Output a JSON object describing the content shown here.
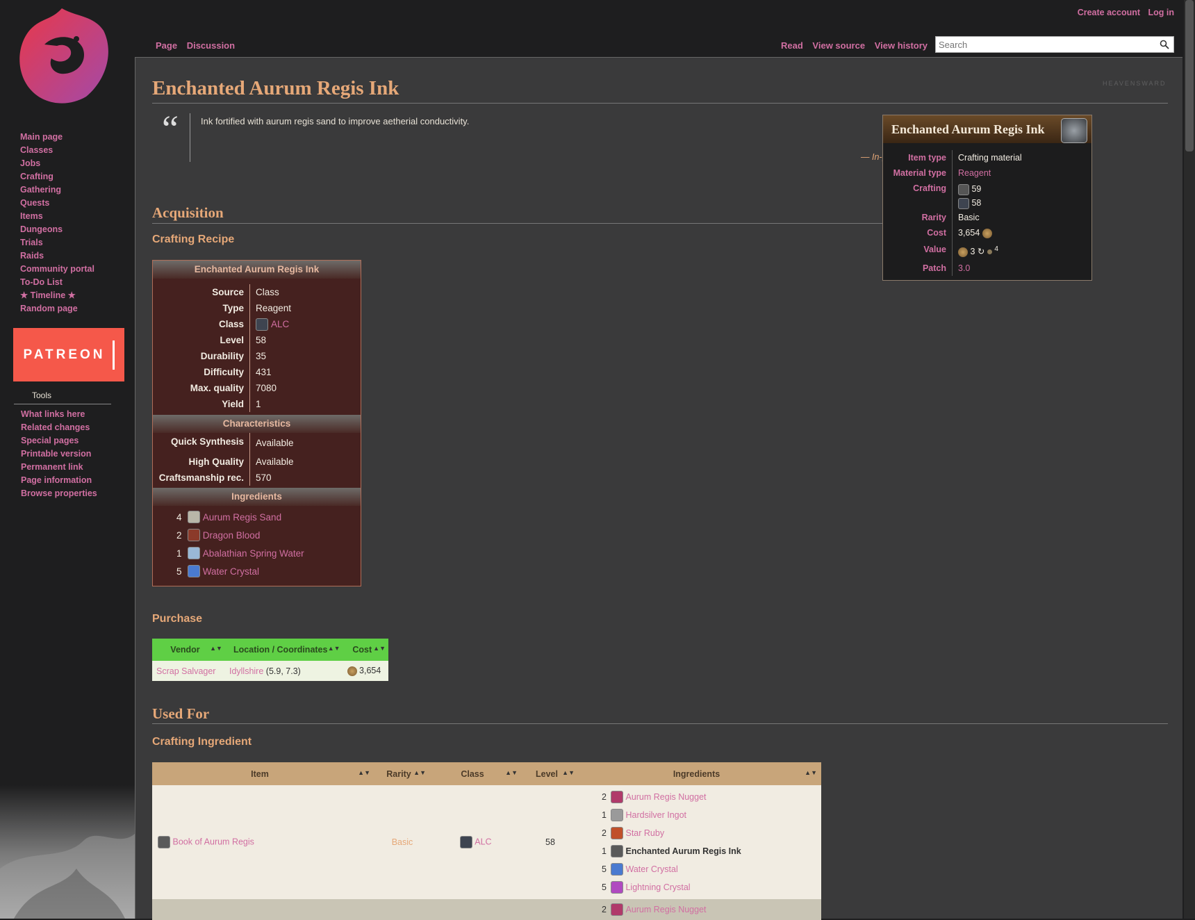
{
  "header": {
    "create_account": "Create account",
    "log_in": "Log in",
    "tab_page": "Page",
    "tab_discussion": "Discussion",
    "tab_read": "Read",
    "tab_view_source": "View source",
    "tab_view_history": "View history",
    "search_placeholder": "Search"
  },
  "sidebar": {
    "nav": [
      "Main page",
      "Classes",
      "Jobs",
      "Crafting",
      "Gathering",
      "Quests",
      "Items",
      "Dungeons",
      "Trials",
      "Raids",
      "Community portal",
      "To-Do List",
      "★ Timeline ★",
      "Random page"
    ],
    "patreon": "PATREON",
    "tools_heading": "Tools",
    "tools": [
      "What links here",
      "Related changes",
      "Special pages",
      "Printable version",
      "Permanent link",
      "Page information",
      "Browse properties"
    ]
  },
  "page": {
    "title": "Enchanted Aurum Regis Ink",
    "watermark": "HEAVENSWARD",
    "quote": "Ink fortified with aurum regis sand to improve aetherial conductivity.",
    "quote_cite": "— In-game description",
    "h_acquisition": "Acquisition",
    "h_crafting_recipe": "Crafting Recipe",
    "h_purchase": "Purchase",
    "h_used_for": "Used For",
    "h_crafting_ingredient": "Crafting Ingredient"
  },
  "recipe": {
    "title": "Enchanted Aurum Regis Ink",
    "rows": [
      {
        "k": "Source",
        "v": "Class"
      },
      {
        "k": "Type",
        "v": "Reagent"
      },
      {
        "k": "Class",
        "v": "ALC"
      },
      {
        "k": "Level",
        "v": "58"
      },
      {
        "k": "Durability",
        "v": "35"
      },
      {
        "k": "Difficulty",
        "v": "431"
      },
      {
        "k": "Max. quality",
        "v": "7080"
      },
      {
        "k": "Yield",
        "v": "1"
      }
    ],
    "characteristics_title": "Characteristics",
    "characteristics": [
      {
        "k": "Quick Synthesis",
        "v": "Available"
      },
      {
        "k": "High Quality",
        "v": "Available"
      },
      {
        "k": "Craftsmanship rec.",
        "v": "570"
      }
    ],
    "ingredients_title": "Ingredients",
    "ingredients": [
      {
        "n": "4",
        "name": "Aurum Regis Sand",
        "color": "#b9b6a8"
      },
      {
        "n": "2",
        "name": "Dragon Blood",
        "color": "#8b3a2a"
      },
      {
        "n": "1",
        "name": "Abalathian Spring Water",
        "color": "#9ab8d6"
      },
      {
        "n": "5",
        "name": "Water Crystal",
        "color": "#4a7ad0"
      }
    ]
  },
  "purchase": {
    "headers": [
      "Vendor",
      "Location / Coordinates",
      "Cost"
    ],
    "row": {
      "vendor": "Scrap Salvager",
      "location": "Idyllshire",
      "coords": "(5.9, 7.3)",
      "cost": "3,654"
    }
  },
  "crafting_table": {
    "headers": [
      "Item",
      "Rarity",
      "Class",
      "Level",
      "Ingredients"
    ],
    "row": {
      "item": "Book of Aurum Regis",
      "rarity": "Basic",
      "class": "ALC",
      "level": "58",
      "ingredients": [
        {
          "n": "2",
          "name": "Aurum Regis Nugget",
          "color": "#b03a6a",
          "bold": false
        },
        {
          "n": "1",
          "name": "Hardsilver Ingot",
          "color": "#9a9a9a",
          "bold": false
        },
        {
          "n": "2",
          "name": "Star Ruby",
          "color": "#c0502a",
          "bold": false
        },
        {
          "n": "1",
          "name": "Enchanted Aurum Regis Ink",
          "color": "#5a5a5a",
          "bold": true
        },
        {
          "n": "5",
          "name": "Water Crystal",
          "color": "#4a7ad0",
          "bold": false
        },
        {
          "n": "5",
          "name": "Lightning Crystal",
          "color": "#b04ac0",
          "bold": false
        }
      ]
    },
    "next_row_ingredient": {
      "n": "2",
      "name": "Aurum Regis Nugget"
    }
  },
  "infobox": {
    "title": "Enchanted Aurum Regis Ink",
    "item_type_label": "Item type",
    "item_type": "Crafting material",
    "material_type_label": "Material type",
    "material_type": "Reagent",
    "crafting_label": "Crafting",
    "crafting_levels": [
      "59",
      "58"
    ],
    "rarity_label": "Rarity",
    "rarity": "Basic",
    "cost_label": "Cost",
    "cost": "3,654",
    "value_label": "Value",
    "value_gil": "3",
    "value_hq": "4",
    "patch_label": "Patch",
    "patch": "3.0"
  }
}
